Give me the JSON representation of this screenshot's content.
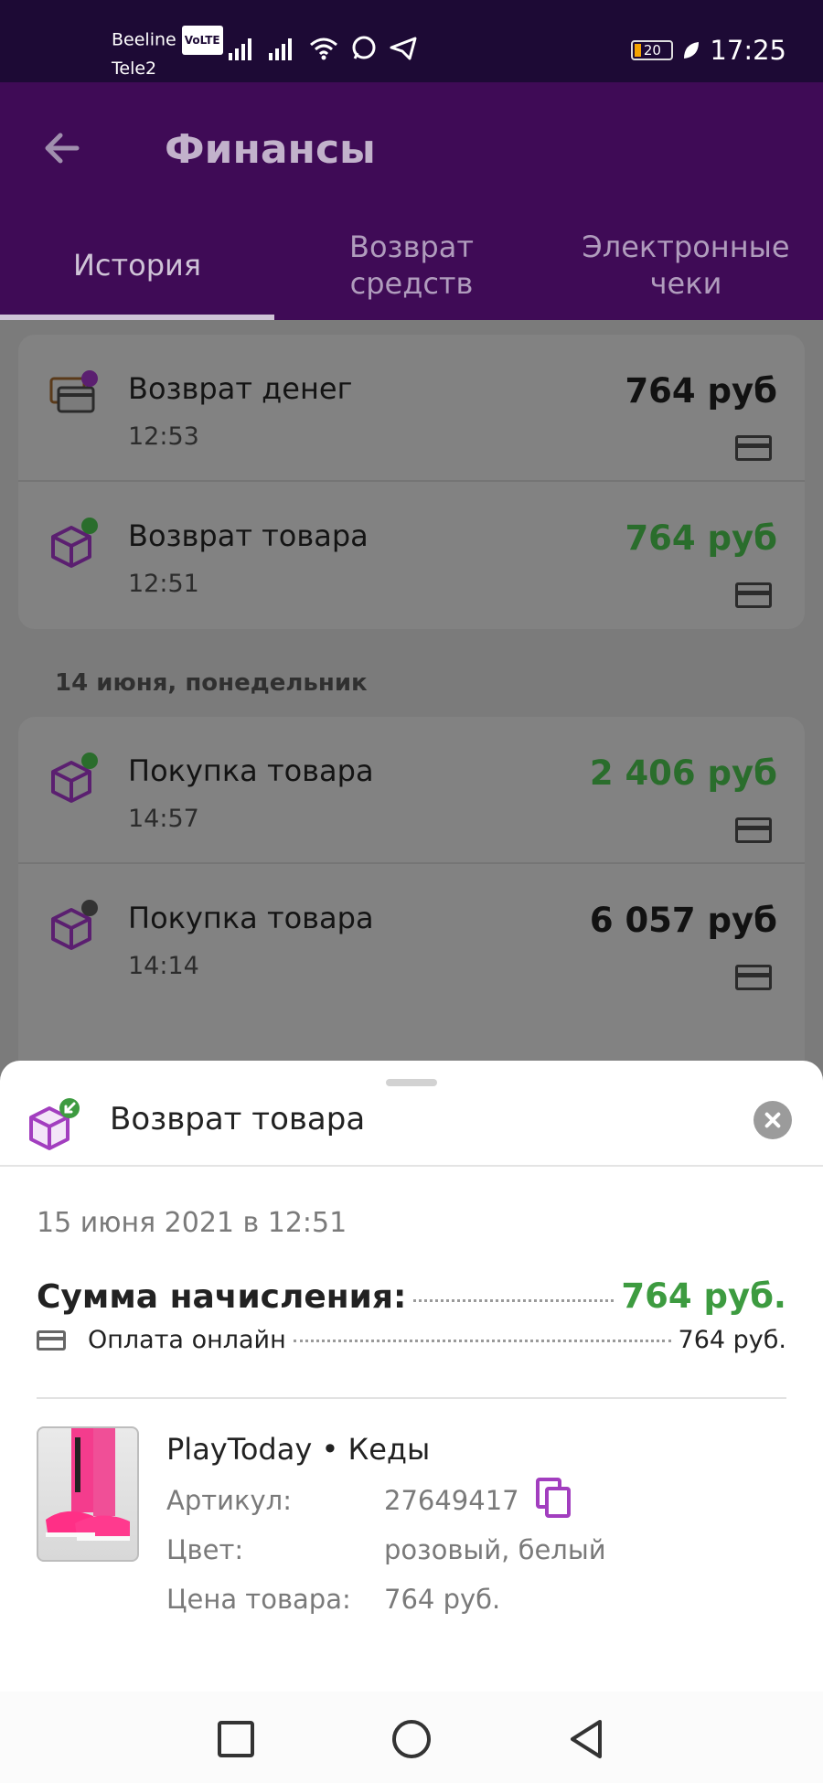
{
  "status_bar": {
    "carrier1": "Beeline",
    "volte": "VoLTE",
    "carrier2": "Tele2",
    "battery": "20",
    "time": "17:25"
  },
  "app_bar": {
    "title": "Финансы",
    "tabs": [
      {
        "label": "История",
        "active": true
      },
      {
        "label": "Возврат средств",
        "active": false
      },
      {
        "label": "Электронные чеки",
        "active": false
      }
    ]
  },
  "history": {
    "group1": [
      {
        "title": "Возврат денег",
        "time": "12:53",
        "amount": "764 руб",
        "amount_color": "#121212",
        "icon": "money-refund-icon"
      },
      {
        "title": "Возврат товара",
        "time": "12:51",
        "amount": "764 руб",
        "amount_color": "#2a6d2c",
        "icon": "package-return-icon"
      }
    ],
    "date_header": "14 июня, понедельник",
    "group2": [
      {
        "title": "Покупка товара",
        "time": "14:57",
        "amount": "2 406 руб",
        "amount_color": "#2a6d2c",
        "icon": "package-return-icon"
      },
      {
        "title": "Покупка товара",
        "time": "14:14",
        "amount": "6 057 руб",
        "amount_color": "#121212",
        "icon": "package-purchase-icon"
      }
    ]
  },
  "sheet": {
    "title": "Возврат товара",
    "date": "15 июня 2021 в 12:51",
    "sum_label": "Сумма начисления:",
    "sum_value": "764 руб.",
    "payment_label": "Оплата онлайн",
    "payment_value": "764 руб.",
    "product": {
      "name": "PlayToday • Кеды",
      "article_label": "Артикул:",
      "article_value": "27649417",
      "color_label": "Цвет:",
      "color_value": "розовый, белый",
      "price_label": "Цена товара:",
      "price_value": "764 руб."
    }
  },
  "colors": {
    "accent_purple": "#a23ebf",
    "green": "#3d9b40",
    "app_bar": "#3f0b56"
  }
}
